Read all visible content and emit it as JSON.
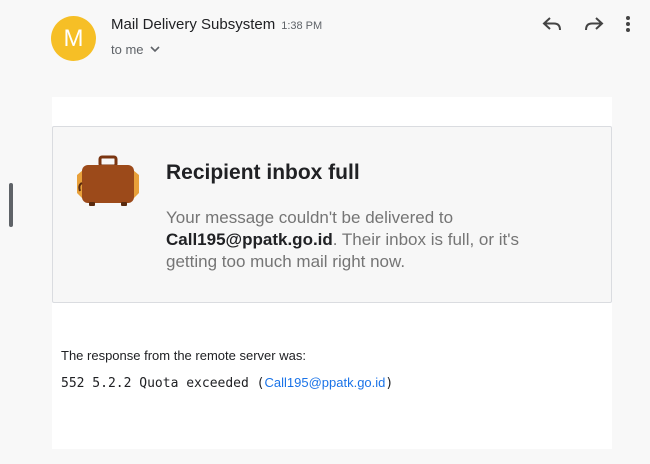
{
  "header": {
    "avatar_letter": "M",
    "avatar_color": "#f6bf26",
    "sender": "Mail Delivery Subsystem",
    "time": "1:38 PM",
    "recipient": "to me"
  },
  "actions": {
    "icons": [
      "reply-icon",
      "forward-icon",
      "more-vert-icon"
    ]
  },
  "card": {
    "icon": "suitcase-icon",
    "title": "Recipient inbox full",
    "text_before": "Your message couldn't be delivered to ",
    "address": "Call195@ppatk.go.id",
    "text_after": ". Their inbox is full, or it's getting too much mail right now."
  },
  "response": {
    "label": "The response from the remote server was:",
    "code_prefix": "552 5.2.2 Quota exceeded (",
    "code_link": "Call195@ppatk.go.id",
    "code_suffix": ")"
  },
  "colors": {
    "link": "#1a73e8",
    "muted": "#757575",
    "bag": "#9c4a1a",
    "bag_accent": "#e8a03a"
  }
}
